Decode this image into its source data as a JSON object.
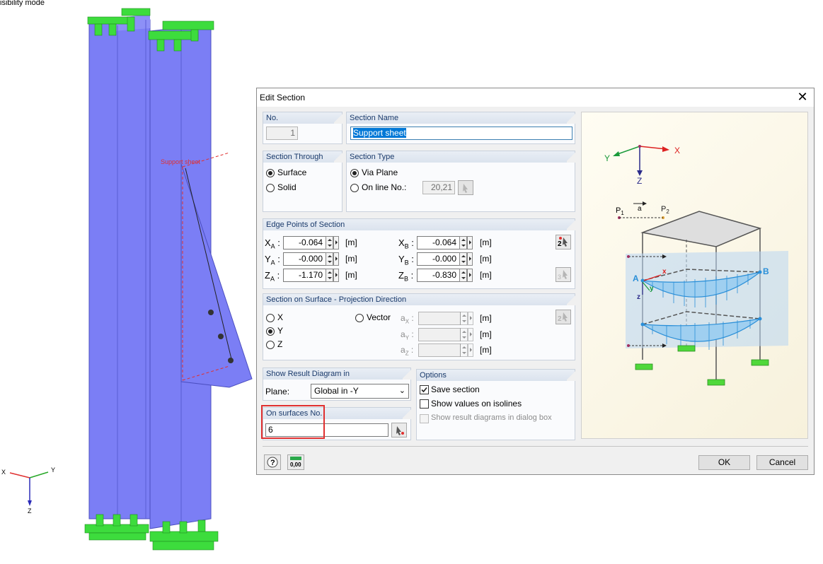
{
  "viewport": {
    "mode_label": "isibility mode",
    "section_label": "Support sheet",
    "axes": {
      "x": "X",
      "y": "Y",
      "z": "Z"
    }
  },
  "dialog": {
    "title": "Edit Section",
    "close_icon": "close-icon",
    "no": {
      "header": "No.",
      "value": "1"
    },
    "section_name": {
      "header": "Section Name",
      "value": "Support sheet"
    },
    "section_through": {
      "header": "Section Through",
      "options": [
        "Surface",
        "Solid"
      ],
      "selected": "Surface"
    },
    "section_type": {
      "header": "Section Type",
      "options": [
        "Via Plane",
        "On line No.:"
      ],
      "selected": "Via Plane",
      "line_no": "20,21"
    },
    "edge_points": {
      "header": "Edge Points of Section",
      "unit": "[m]",
      "xa_label": "X",
      "xa_sub": "A",
      "xa": "-0.064",
      "ya_label": "Y",
      "ya_sub": "A",
      "ya": "-0.000",
      "za_label": "Z",
      "za_sub": "A",
      "za": "-1.170",
      "xb_label": "X",
      "xb_sub": "B",
      "xb": "-0.064",
      "yb_label": "Y",
      "yb_sub": "B",
      "yb": "-0.000",
      "zb_label": "Z",
      "zb_sub": "B",
      "zb": "-0.830"
    },
    "projection": {
      "header": "Section on Surface - Projection Direction",
      "options": [
        "X",
        "Y",
        "Z"
      ],
      "selected": "Y",
      "vector_label": "Vector",
      "ax_label": "a",
      "ax_sub": "X",
      "ay_label": "a",
      "ay_sub": "Y",
      "az_label": "a",
      "az_sub": "Z",
      "unit": "[m]"
    },
    "result_diagram": {
      "header": "Show Result Diagram in",
      "plane_label": "Plane:",
      "plane_value": "Global in -Y"
    },
    "surfaces": {
      "header": "On surfaces No.",
      "value": "6"
    },
    "options": {
      "header": "Options",
      "save_section": "Save section",
      "save_checked": true,
      "show_isolines": "Show values on isolines",
      "isolines_checked": false,
      "show_result_diagrams": "Show result diagrams in dialog box"
    },
    "preview": {
      "x": "X",
      "y": "Y",
      "z": "Z",
      "a": "A",
      "b": "B",
      "a_small": "a",
      "p1": "P",
      "p1_sub": "1",
      "p2": "P",
      "p2_sub": "2",
      "x_red": "x",
      "y_small": "y",
      "z_small": "z"
    },
    "buttons": {
      "ok": "OK",
      "cancel": "Cancel",
      "calc_icon_text": "0,00"
    },
    "colors": {
      "surface": "#7b7ef5",
      "support": "#3ddc3d",
      "section_line": "#e03030",
      "diagram": "#2a8fd8"
    }
  }
}
